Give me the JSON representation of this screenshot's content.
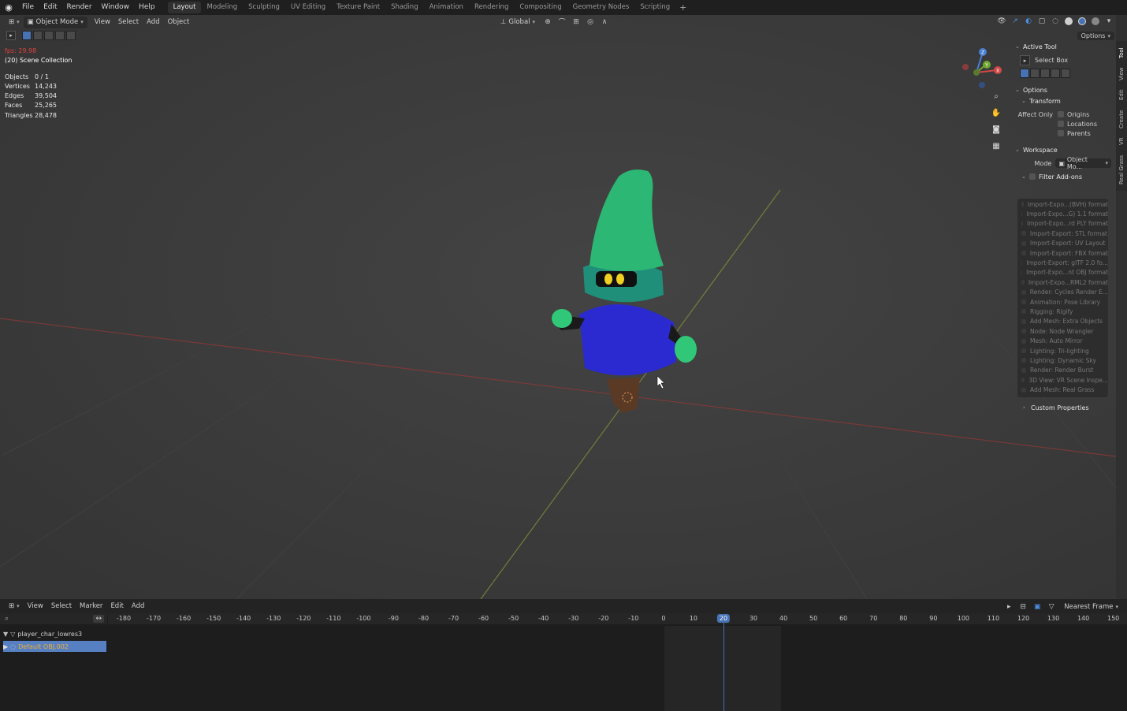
{
  "menubar": {
    "menus": [
      "File",
      "Edit",
      "Render",
      "Window",
      "Help"
    ],
    "workspaces": [
      "Layout",
      "Modeling",
      "Sculpting",
      "UV Editing",
      "Texture Paint",
      "Shading",
      "Animation",
      "Rendering",
      "Compositing",
      "Geometry Nodes",
      "Scripting"
    ],
    "add_tab": "+"
  },
  "viewport_header": {
    "mode": "Object Mode",
    "menus": [
      "View",
      "Select",
      "Add",
      "Object"
    ],
    "orientation": "Global",
    "options_label": "Options"
  },
  "overlay": {
    "fps": "fps: 29.98",
    "collection": "(20) Scene Collection",
    "stats": [
      {
        "label": "Objects",
        "value": "0 / 1"
      },
      {
        "label": "Vertices",
        "value": "14,243"
      },
      {
        "label": "Edges",
        "value": "39,504"
      },
      {
        "label": "Faces",
        "value": "25,265"
      },
      {
        "label": "Triangles",
        "value": "28,478"
      }
    ]
  },
  "gizmo": {
    "x_label": "X",
    "y_label": "Y",
    "z_label": "Z"
  },
  "npanel": {
    "active_tool_header": "Active Tool",
    "active_tool": "Select Box",
    "options_header": "Options",
    "transform_header": "Transform",
    "affect_only_label": "Affect Only",
    "affect_only_items": [
      "Origins",
      "Locations",
      "Parents"
    ],
    "workspace_header": "Workspace",
    "mode_label": "Mode",
    "mode_value": "Object Mo...",
    "filter_addons": "Filter Add-ons",
    "addons": [
      "Import-Expo...(BVH) format",
      "Import-Expo...G) 1.1 format",
      "Import-Expo...rd PLY format",
      "Import-Export: STL format",
      "Import-Export: UV Layout",
      "Import-Export: FBX format",
      "Import-Export: glTF 2.0 fo...",
      "Import-Expo...nt OBJ format",
      "Import-Expo...RML2 format",
      "Render: Cycles Render E...",
      "Animation: Pose Library",
      "Rigging: Rigify",
      "Add Mesh: Extra Objects",
      "Node: Node Wrangler",
      "Mesh: Auto Mirror",
      "Lighting: Tri-lighting",
      "Lighting: Dynamic Sky",
      "Render: Render Burst",
      "3D View: VR Scene Inspe...",
      "Add Mesh: Real Grass"
    ],
    "custom_properties": "Custom Properties",
    "side_tabs": [
      "Tool",
      "View",
      "Edit",
      "Create",
      "VR",
      "Real Grass"
    ]
  },
  "timeline": {
    "menus": [
      "View",
      "Select",
      "Marker",
      "Edit",
      "Add"
    ],
    "snap": "Nearest Frame",
    "ticks": [
      "-180",
      "-170",
      "-160",
      "-150",
      "-140",
      "-130",
      "-120",
      "-110",
      "-100",
      "-90",
      "-80",
      "-70",
      "-60",
      "-50",
      "-40",
      "-30",
      "-20",
      "-10",
      "0",
      "10",
      "20",
      "30",
      "40",
      "50",
      "60",
      "70",
      "80",
      "90",
      "100",
      "110",
      "120",
      "130",
      "140",
      "150"
    ],
    "current_frame": "20",
    "tree": [
      {
        "label": "player_char_lowres3"
      },
      {
        "label": "Default OBJ.002"
      }
    ]
  },
  "colors": {
    "accent": "#4772b3",
    "hat": "#2cb874",
    "body": "#2a2ad0",
    "fps": "#e04040"
  }
}
